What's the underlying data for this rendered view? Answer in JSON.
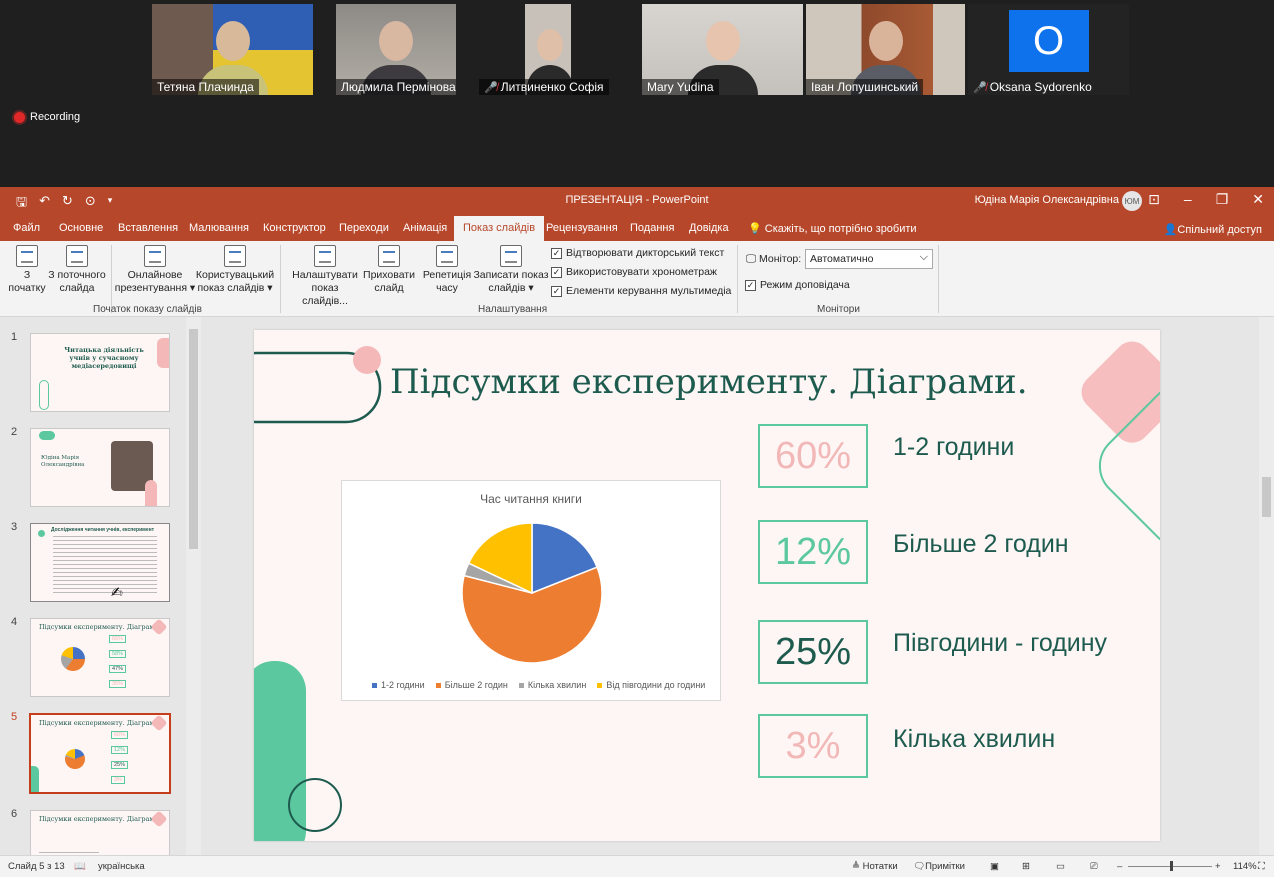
{
  "meeting": {
    "participants": [
      {
        "name": "Тетяна Плачинда",
        "muted": false,
        "active": false
      },
      {
        "name": "Людмила Пермінова",
        "muted": false,
        "active": false
      },
      {
        "name": "Литвиненко Софія",
        "muted": true,
        "active": false
      },
      {
        "name": "Mary Yudina",
        "muted": false,
        "active": true
      },
      {
        "name": "Іван Лопушинський",
        "muted": false,
        "active": false
      },
      {
        "name": "Oksana Sydorenko",
        "muted": true,
        "active": false,
        "avatar_letter": "O"
      }
    ],
    "recording_label": "Recording"
  },
  "app": {
    "title": "ПРЕЗЕНТАЦІЯ  -  PowerPoint",
    "user_name": "Юдіна Марія Олександрівна",
    "user_initials": "ЮМ"
  },
  "tabs": [
    {
      "label": "Файл"
    },
    {
      "label": "Основне"
    },
    {
      "label": "Вставлення"
    },
    {
      "label": "Малювання"
    },
    {
      "label": "Конструктор"
    },
    {
      "label": "Переходи"
    },
    {
      "label": "Анімація"
    },
    {
      "label": "Показ слайдів"
    },
    {
      "label": "Рецензування"
    },
    {
      "label": "Подання"
    },
    {
      "label": "Довідка"
    }
  ],
  "tell_me": "Скажіть, що потрібно зробити",
  "share": "Спільний доступ",
  "ribbon": {
    "from_start": [
      "З",
      "початку"
    ],
    "from_current": [
      "З поточного",
      "слайда"
    ],
    "online": [
      "Онлайнове",
      "презентування ▾"
    ],
    "custom": [
      "Користувацький",
      "показ слайдів ▾"
    ],
    "group_start": "Початок показу слайдів",
    "setup": [
      "Налаштувати",
      "показ слайдів..."
    ],
    "hide": [
      "Приховати",
      "слайд"
    ],
    "rehearse": [
      "Репетиція",
      "часу"
    ],
    "record": [
      "Записати показ",
      "слайдів ▾"
    ],
    "chk_narration": "Відтворювати дикторський текст",
    "chk_timings": "Використовувати хронометраж",
    "chk_media": "Елементи керування мультимедіа",
    "group_setup": "Налаштування",
    "monitor_label": "Монітор:",
    "monitor_value": "Автоматично",
    "chk_presenter": "Режим доповідача",
    "group_monitors": "Монітори"
  },
  "thumbs": {
    "numbers": [
      "1",
      "2",
      "3",
      "4",
      "5",
      "6"
    ],
    "t1_title": "Читацька діяльність учнів у сучасному медіасередовищі",
    "t2_name": "Юдіна Марія Олександрівна",
    "t3_title": "Дослідження читання учнів, експеримент",
    "t4_title": "Підсумки експерименту. Діаграми",
    "t4_stats": [
      "65%",
      "58%",
      "47%",
      "35%"
    ],
    "t5_title": "Підсумки експерименту. Діаграми",
    "t5_stats": [
      "60%",
      "12%",
      "25%",
      "3%"
    ],
    "t6_title": "Підсумки експерименту. Діаграми"
  },
  "slide": {
    "title": "Підсумки експерименту. Діаграми.",
    "stats": [
      {
        "value": "60%",
        "label": "1-2 години",
        "color": "#f2b8b8"
      },
      {
        "value": "12%",
        "label": "Більше 2 годин",
        "color": "#5cc89f"
      },
      {
        "value": "25%",
        "label": "Півгодини - годину",
        "color": "#1e5b4f"
      },
      {
        "value": "3%",
        "label": "Кілька хвилин",
        "color": "#f2b8b8"
      }
    ]
  },
  "chart_data": {
    "type": "pie",
    "title": "Час читання книги",
    "categories": [
      "1-2 години",
      "Більше 2 годин",
      "Кілька хвилин",
      "Від півгодини до години"
    ],
    "values": [
      19,
      60,
      3,
      18
    ],
    "colors": [
      "#4472c4",
      "#ed7d31",
      "#a5a5a5",
      "#ffc000"
    ],
    "legend": "bottom"
  },
  "status": {
    "slide_info": "Слайд 5 з 13",
    "language": "українська",
    "notes": "Нотатки",
    "comments": "Примітки",
    "zoom": "114%"
  }
}
